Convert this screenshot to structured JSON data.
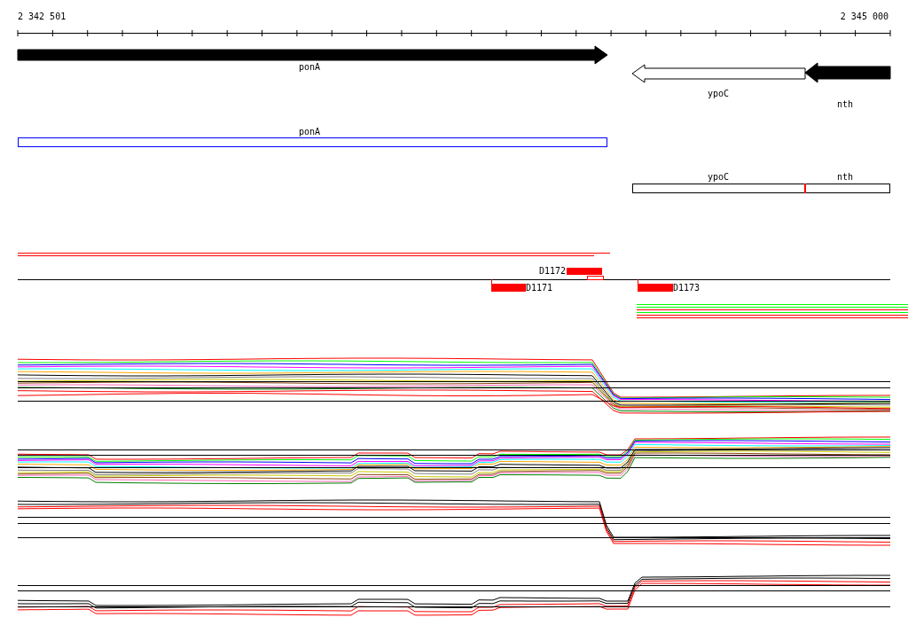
{
  "ruler": {
    "start_label": "2 342 501",
    "end_label": "2 345 000"
  },
  "genes": [
    {
      "name": "ponA",
      "kind": "forward",
      "filled": true
    },
    {
      "name": "ypoC",
      "kind": "reverse",
      "filled": false
    },
    {
      "name": "nth",
      "kind": "reverse",
      "filled": true
    }
  ],
  "transcripts": [
    {
      "kind": "single",
      "segments": [
        {
          "name": "ponA"
        }
      ]
    },
    {
      "kind": "joined",
      "segments": [
        {
          "name": "ypoC"
        },
        {
          "name": "nth"
        }
      ]
    }
  ],
  "features": [
    {
      "label": "D1172",
      "kind": "above"
    },
    {
      "label": "D1171",
      "kind": "below"
    },
    {
      "label": "D1173",
      "kind": "below"
    }
  ]
}
